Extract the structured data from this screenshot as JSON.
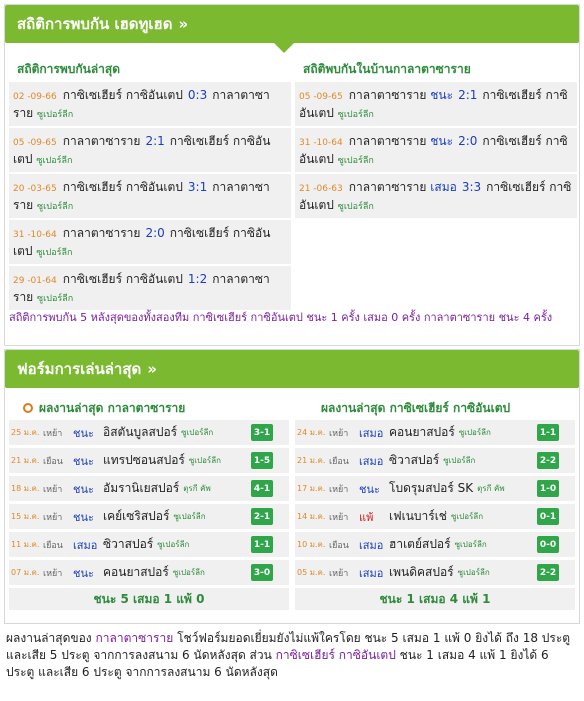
{
  "h2h": {
    "title": "สถิติการพบกัน เฮดทูเฮด",
    "chevron": "»",
    "left_title": "สถิติการพบกันล่าสุด",
    "right_title": "สถิติพบกันในบ้านกาลาตาซาราย",
    "left_rows": [
      {
        "date": "02 -09-66",
        "home": "กาซิเซเฮียร์ กาซิอันเตป",
        "score": "0:3",
        "away": "กาลาตาซาราย",
        "league": "ซูเปอร์ลีก"
      },
      {
        "date": "05 -09-65",
        "home": "กาลาตาซาราย",
        "score": "2:1",
        "away": "กาซิเซเฮียร์ กาซิอันเตป",
        "league": "ซูเปอร์ลีก"
      },
      {
        "date": "20 -03-65",
        "home": "กาซิเซเฮียร์ กาซิอันเตป",
        "score": "3:1",
        "away": "กาลาตาซาราย",
        "league": "ซูเปอร์ลีก"
      },
      {
        "date": "31 -10-64",
        "home": "กาลาตาซาราย",
        "score": "2:0",
        "away": "กาซิเซเฮียร์ กาซิอันเตป",
        "league": "ซูเปอร์ลีก"
      },
      {
        "date": "29 -01-64",
        "home": "กาซิเซเฮียร์ กาซิอันเตป",
        "score": "1:2",
        "away": "กาลาตาซาราย",
        "league": "ซูเปอร์ลีก"
      }
    ],
    "right_rows": [
      {
        "date": "05 -09-65",
        "home": "กาลาตาซาราย",
        "result": "ชนะ",
        "score": "2:1",
        "away": "กาซิเซเฮียร์ กาซิอันเตป",
        "league": "ซูเปอร์ลีก"
      },
      {
        "date": "31 -10-64",
        "home": "กาลาตาซาราย",
        "result": "ชนะ",
        "score": "2:0",
        "away": "กาซิเซเฮียร์ กาซิอันเตป",
        "league": "ซูเปอร์ลีก"
      },
      {
        "date": "21 -06-63",
        "home": "กาลาตาซาราย",
        "result": "เสมอ",
        "score": "3:3",
        "away": "กาซิเซเฮียร์ กาซิอันเตป",
        "league": "ซูเปอร์ลีก"
      }
    ],
    "summary": "สถิติการพบกัน 5 หลังสุดของทั้งสองทีม กาซิเซเฮียร์ กาซิอันเตป ชนะ 1 ครั้ง เสมอ 0 ครั้ง กาลาตาซาราย ชนะ 4 ครั้ง"
  },
  "form": {
    "title": "ฟอร์มการเล่นล่าสุด",
    "chevron": "»",
    "left_title": "ผลงานล่าสุด กาลาตาซาราย",
    "right_title": "ผลงานล่าสุด กาซิเซเฮียร์ กาซิอันเตป",
    "left_rows": [
      {
        "date": "25 ม.ค.",
        "venue": "เหย้า",
        "result": "ชนะ",
        "rtype": "win",
        "opp": "อิสตันบูลสปอร์",
        "league": "ซูเปอร์ลีก",
        "score": "3-1"
      },
      {
        "date": "21 ม.ค.",
        "venue": "เยือน",
        "result": "ชนะ",
        "rtype": "win",
        "opp": "แทรปซอนสปอร์",
        "league": "ซูเปอร์ลีก",
        "score": "1-5"
      },
      {
        "date": "18 ม.ค.",
        "venue": "เหย้า",
        "result": "ชนะ",
        "rtype": "win",
        "opp": "อัมรานิเยสปอร์",
        "league": "ตุรกี คัพ",
        "score": "4-1"
      },
      {
        "date": "15 ม.ค.",
        "venue": "เหย้า",
        "result": "ชนะ",
        "rtype": "win",
        "opp": "เคย์เซริสปอร์",
        "league": "ซูเปอร์ลีก",
        "score": "2-1"
      },
      {
        "date": "11 ม.ค.",
        "venue": "เยือน",
        "result": "เสมอ",
        "rtype": "draw",
        "opp": "ซิวาสปอร์",
        "league": "ซูเปอร์ลีก",
        "score": "1-1"
      },
      {
        "date": "07 ม.ค.",
        "venue": "เหย้า",
        "result": "ชนะ",
        "rtype": "win",
        "opp": "คอนยาสปอร์",
        "league": "ซูเปอร์ลีก",
        "score": "3-0"
      }
    ],
    "right_rows": [
      {
        "date": "24 ม.ค.",
        "venue": "เหย้า",
        "result": "เสมอ",
        "rtype": "draw",
        "opp": "คอนยาสปอร์",
        "league": "ซูเปอร์ลีก",
        "score": "1-1"
      },
      {
        "date": "21 ม.ค.",
        "venue": "เยือน",
        "result": "เสมอ",
        "rtype": "draw",
        "opp": "ซิวาสปอร์",
        "league": "ซูเปอร์ลีก",
        "score": "2-2"
      },
      {
        "date": "17 ม.ค.",
        "venue": "เหย้า",
        "result": "ชนะ",
        "rtype": "win",
        "opp": "โบดรุมสปอร์ SK",
        "league": "ตุรกี คัพ",
        "score": "1-0"
      },
      {
        "date": "14 ม.ค.",
        "venue": "เหย้า",
        "result": "แพ้",
        "rtype": "loss",
        "opp": "เฟเนบาร์เช่",
        "league": "ซูเปอร์ลีก",
        "score": "0-1"
      },
      {
        "date": "10 ม.ค.",
        "venue": "เยือน",
        "result": "เสมอ",
        "rtype": "draw",
        "opp": "ฮาเตย์สปอร์",
        "league": "ซูเปอร์ลีก",
        "score": "0-0"
      },
      {
        "date": "05 ม.ค.",
        "venue": "เหย้า",
        "result": "เสมอ",
        "rtype": "draw",
        "opp": "เพนดิคสปอร์",
        "league": "ซูเปอร์ลีก",
        "score": "2-2"
      }
    ],
    "left_summary": "ชนะ 5 เสมอ 1 แพ้ 0",
    "right_summary": "ชนะ 1 เสมอ 4 แพ้ 1"
  },
  "footer": {
    "p1": "ผลงานล่าสุดของ",
    "team1": "กาลาตาซาราย",
    "p2": "โชว์ฟอร์มยอดเยี่ยมยังไม่แพ้ใครโดย ชนะ 5 เสมอ 1 แพ้ 0 ยิงได้ ถึง 18 ประตู และเสีย 5 ประตู จากการลงสนาม 6 นัดหลังสุด ส่วน",
    "team2": "กาซิเซเฮียร์ กาซิอันเตป",
    "p3": "ชนะ 1 เสมอ 4 แพ้ 1 ยิงได้ 6 ประตู และเสีย 6 ประตู จากการลงสนาม 6 นัดหลังสุด"
  },
  "colors": {
    "header_green": "#7ab930",
    "badge_green": "#2fa64a",
    "win_blue": "#1a3fbf",
    "loss_red": "#d01d1d",
    "summary_purple": "#7a1fa0"
  }
}
